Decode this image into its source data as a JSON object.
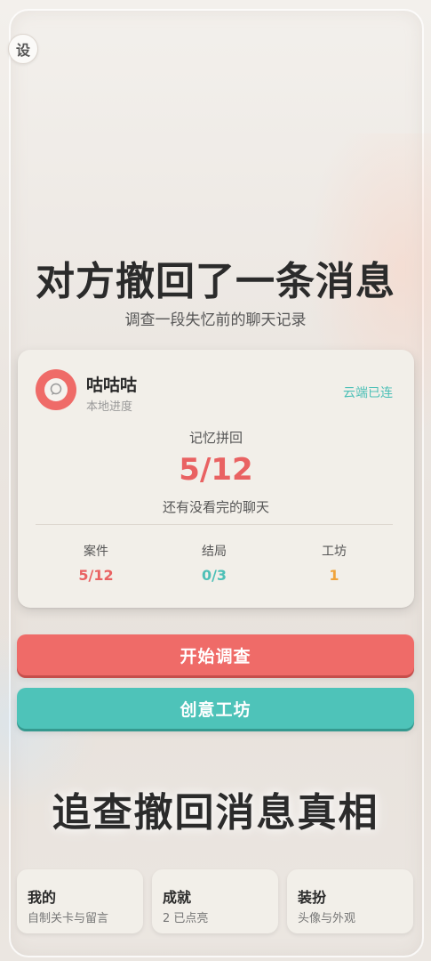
{
  "header": {
    "settings_label": "设"
  },
  "hero": {
    "title": "对方撤回了一条消息",
    "subtitle": "调查一段失忆前的聊天记录"
  },
  "card": {
    "avatar_icon": "speech-bubble-icon",
    "user_name": "咕咕咕",
    "user_sub": "本地进度",
    "cloud_status": "云端已连",
    "progress_label": "记忆拼回",
    "progress_value": "5/12",
    "progress_hint": "还有没看完的聊天",
    "stats": [
      {
        "label": "案件",
        "value": "5/12",
        "color": "#e96262"
      },
      {
        "label": "结局",
        "value": "0/3",
        "color": "#4ec0b7"
      },
      {
        "label": "工坊",
        "value": "1",
        "color": "#f0a33a"
      }
    ]
  },
  "buttons": {
    "start": "开始调查",
    "workshop": "创意工坊"
  },
  "slogan": "追查撤回消息真相",
  "tiles": [
    {
      "title": "我的",
      "sub": "自制关卡与留言"
    },
    {
      "title": "成就",
      "sub": "2 已点亮"
    },
    {
      "title": "装扮",
      "sub": "头像与外观"
    }
  ],
  "colors": {
    "red": "#ef6b68",
    "teal": "#4ec3b9",
    "orange": "#f0a33a"
  }
}
